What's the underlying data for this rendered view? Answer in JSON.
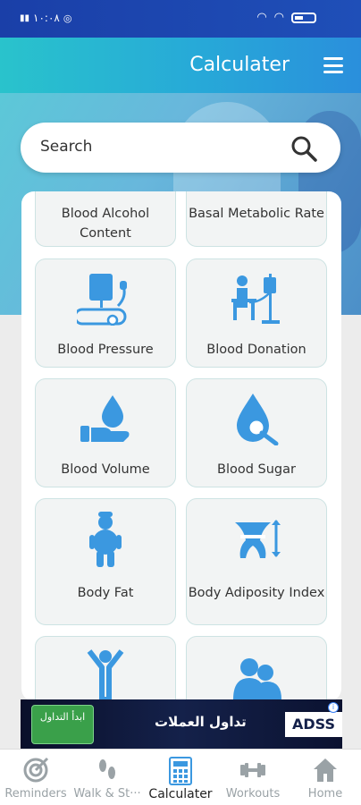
{
  "status": {
    "left_text": "١٠:٠٨",
    "battery": ""
  },
  "header": {
    "title": "Calculater"
  },
  "search": {
    "placeholder": "Search"
  },
  "cards": [
    {
      "id": "blood-alcohol",
      "label": "Blood Alcohol Content",
      "icon": "none"
    },
    {
      "id": "basal-metabolic",
      "label": "Basal Metabolic Rate",
      "icon": "none"
    },
    {
      "id": "blood-pressure",
      "label": "Blood Pressure",
      "icon": "blood-pressure-icon"
    },
    {
      "id": "blood-donation",
      "label": "Blood Donation",
      "icon": "blood-donation-icon"
    },
    {
      "id": "blood-volume",
      "label": "Blood Volume",
      "icon": "blood-volume-icon"
    },
    {
      "id": "blood-sugar",
      "label": "Blood Sugar",
      "icon": "blood-sugar-icon"
    },
    {
      "id": "body-fat",
      "label": "Body Fat",
      "icon": "body-fat-icon"
    },
    {
      "id": "body-adiposity",
      "label": "Body Adiposity Index",
      "icon": "body-adiposity-icon"
    }
  ],
  "ad": {
    "button": "ابدأ التداول",
    "text": "تداول العملات",
    "logo": "ADSS",
    "info": "i"
  },
  "tabs": [
    {
      "label": "Reminders",
      "icon": "target-icon"
    },
    {
      "label": "Walk & St···",
      "icon": "footsteps-icon"
    },
    {
      "label": "Calculater",
      "icon": "calculator-icon",
      "active": true
    },
    {
      "label": "Workouts",
      "icon": "dumbbell-icon"
    },
    {
      "label": "Home",
      "icon": "home-icon"
    }
  ],
  "colors": {
    "accent": "#3b98e0",
    "header_start": "#29c3cc",
    "status_bar": "#1a3fa8"
  }
}
